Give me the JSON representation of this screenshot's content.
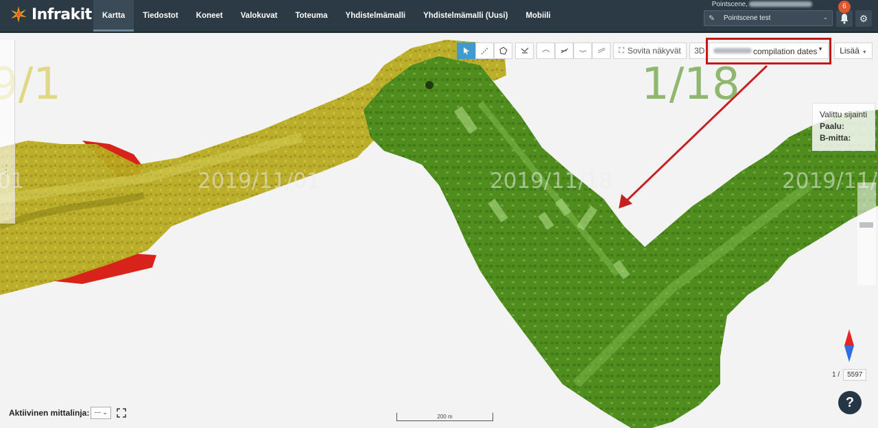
{
  "header": {
    "brand": "Infrakit",
    "user_label": "Pointscene,",
    "project": "Pointscene test",
    "notification_count": "6",
    "nav": [
      {
        "label": "Kartta",
        "active": true
      },
      {
        "label": "Tiedostot"
      },
      {
        "label": "Koneet"
      },
      {
        "label": "Valokuvat"
      },
      {
        "label": "Toteuma"
      },
      {
        "label": "Yhdistelmämalli"
      },
      {
        "label": "Yhdistelmämalli (Uusi)"
      },
      {
        "label": "Mobiili"
      }
    ]
  },
  "toolbar": {
    "fit_views": "Sovita näkyvät",
    "three_d": "3D",
    "compilation": "compilation dates",
    "more": "Lisää"
  },
  "map": {
    "date_labels": [
      "01",
      "2019/11/01",
      "2019/11/18",
      "2019/11/"
    ],
    "big_labels": [
      "9/1",
      "1/18"
    ],
    "colors": {
      "yellow_layer": "#b5a81d",
      "green_layer": "#4e8d1f",
      "red_layer": "#d8231b",
      "highlight": "#c01818"
    }
  },
  "info_panel": {
    "title": "Valittu sijainti",
    "station": "Paalu:",
    "offset": "B-mitta:"
  },
  "bottom": {
    "active_line_label": "Aktiivinen mittalinja:",
    "active_line_value": "---",
    "scale": "200 m",
    "page_current": "1 /",
    "page_total": "5597",
    "help": "?"
  }
}
